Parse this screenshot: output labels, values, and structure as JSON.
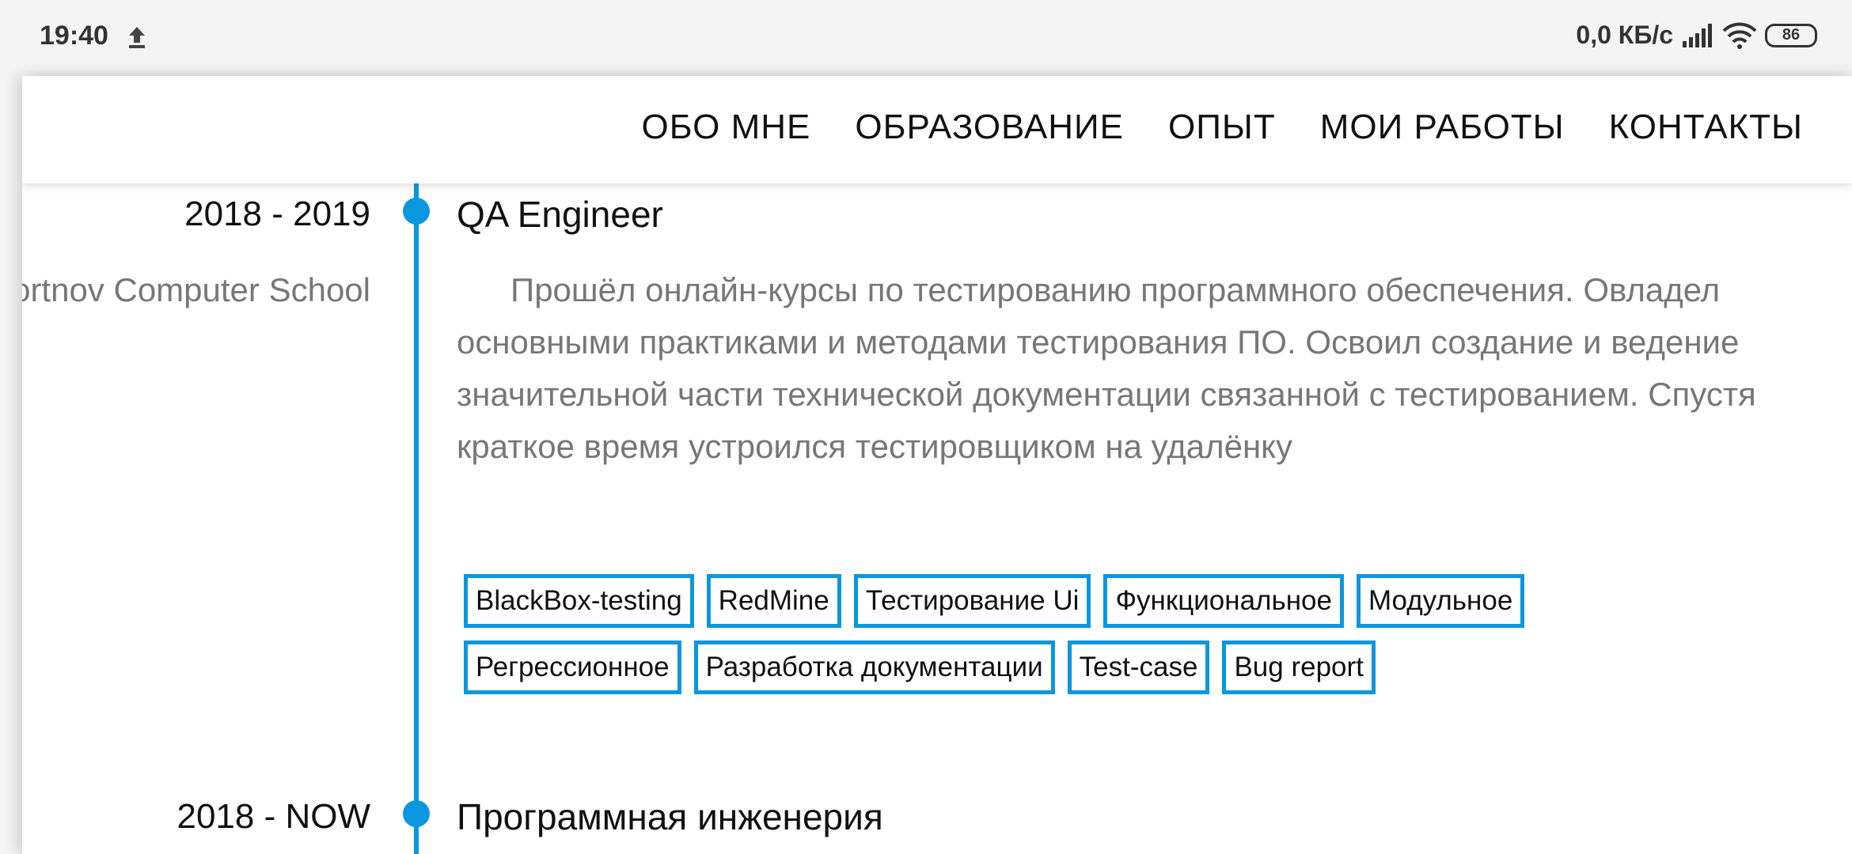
{
  "status_bar": {
    "time": "19:40",
    "network_speed": "0,0 КБ/с",
    "battery": "86"
  },
  "nav": {
    "items": [
      "ОБО МНЕ",
      "ОБРАЗОВАНИЕ",
      "ОПЫТ",
      "МОИ РАБОТЫ",
      "КОНТАКТЫ"
    ]
  },
  "entries": [
    {
      "date": "2018 - 2019",
      "title": "QA Engineer",
      "org": "Portnov Computer School",
      "description": "Прошёл онлайн-курсы по тестированию программного обеспечения. Овладел основными практиками и методами тестирования ПО. Освоил создание и ведение значительной части технической документации связанной с тестированием. Спустя краткое время устроился тестировщиком на удалёнку",
      "tags": [
        "BlackBox-testing",
        "RedMine",
        "Тестирование Ui",
        "Функциональное",
        "Модульное",
        "Регрессионное",
        "Разработка документации",
        "Test-case",
        "Bug report"
      ]
    },
    {
      "date": "2018 - NOW",
      "title": "Программная инженерия"
    }
  ],
  "colors": {
    "accent": "#0a97e0",
    "text": "#111111",
    "muted": "#777777"
  }
}
